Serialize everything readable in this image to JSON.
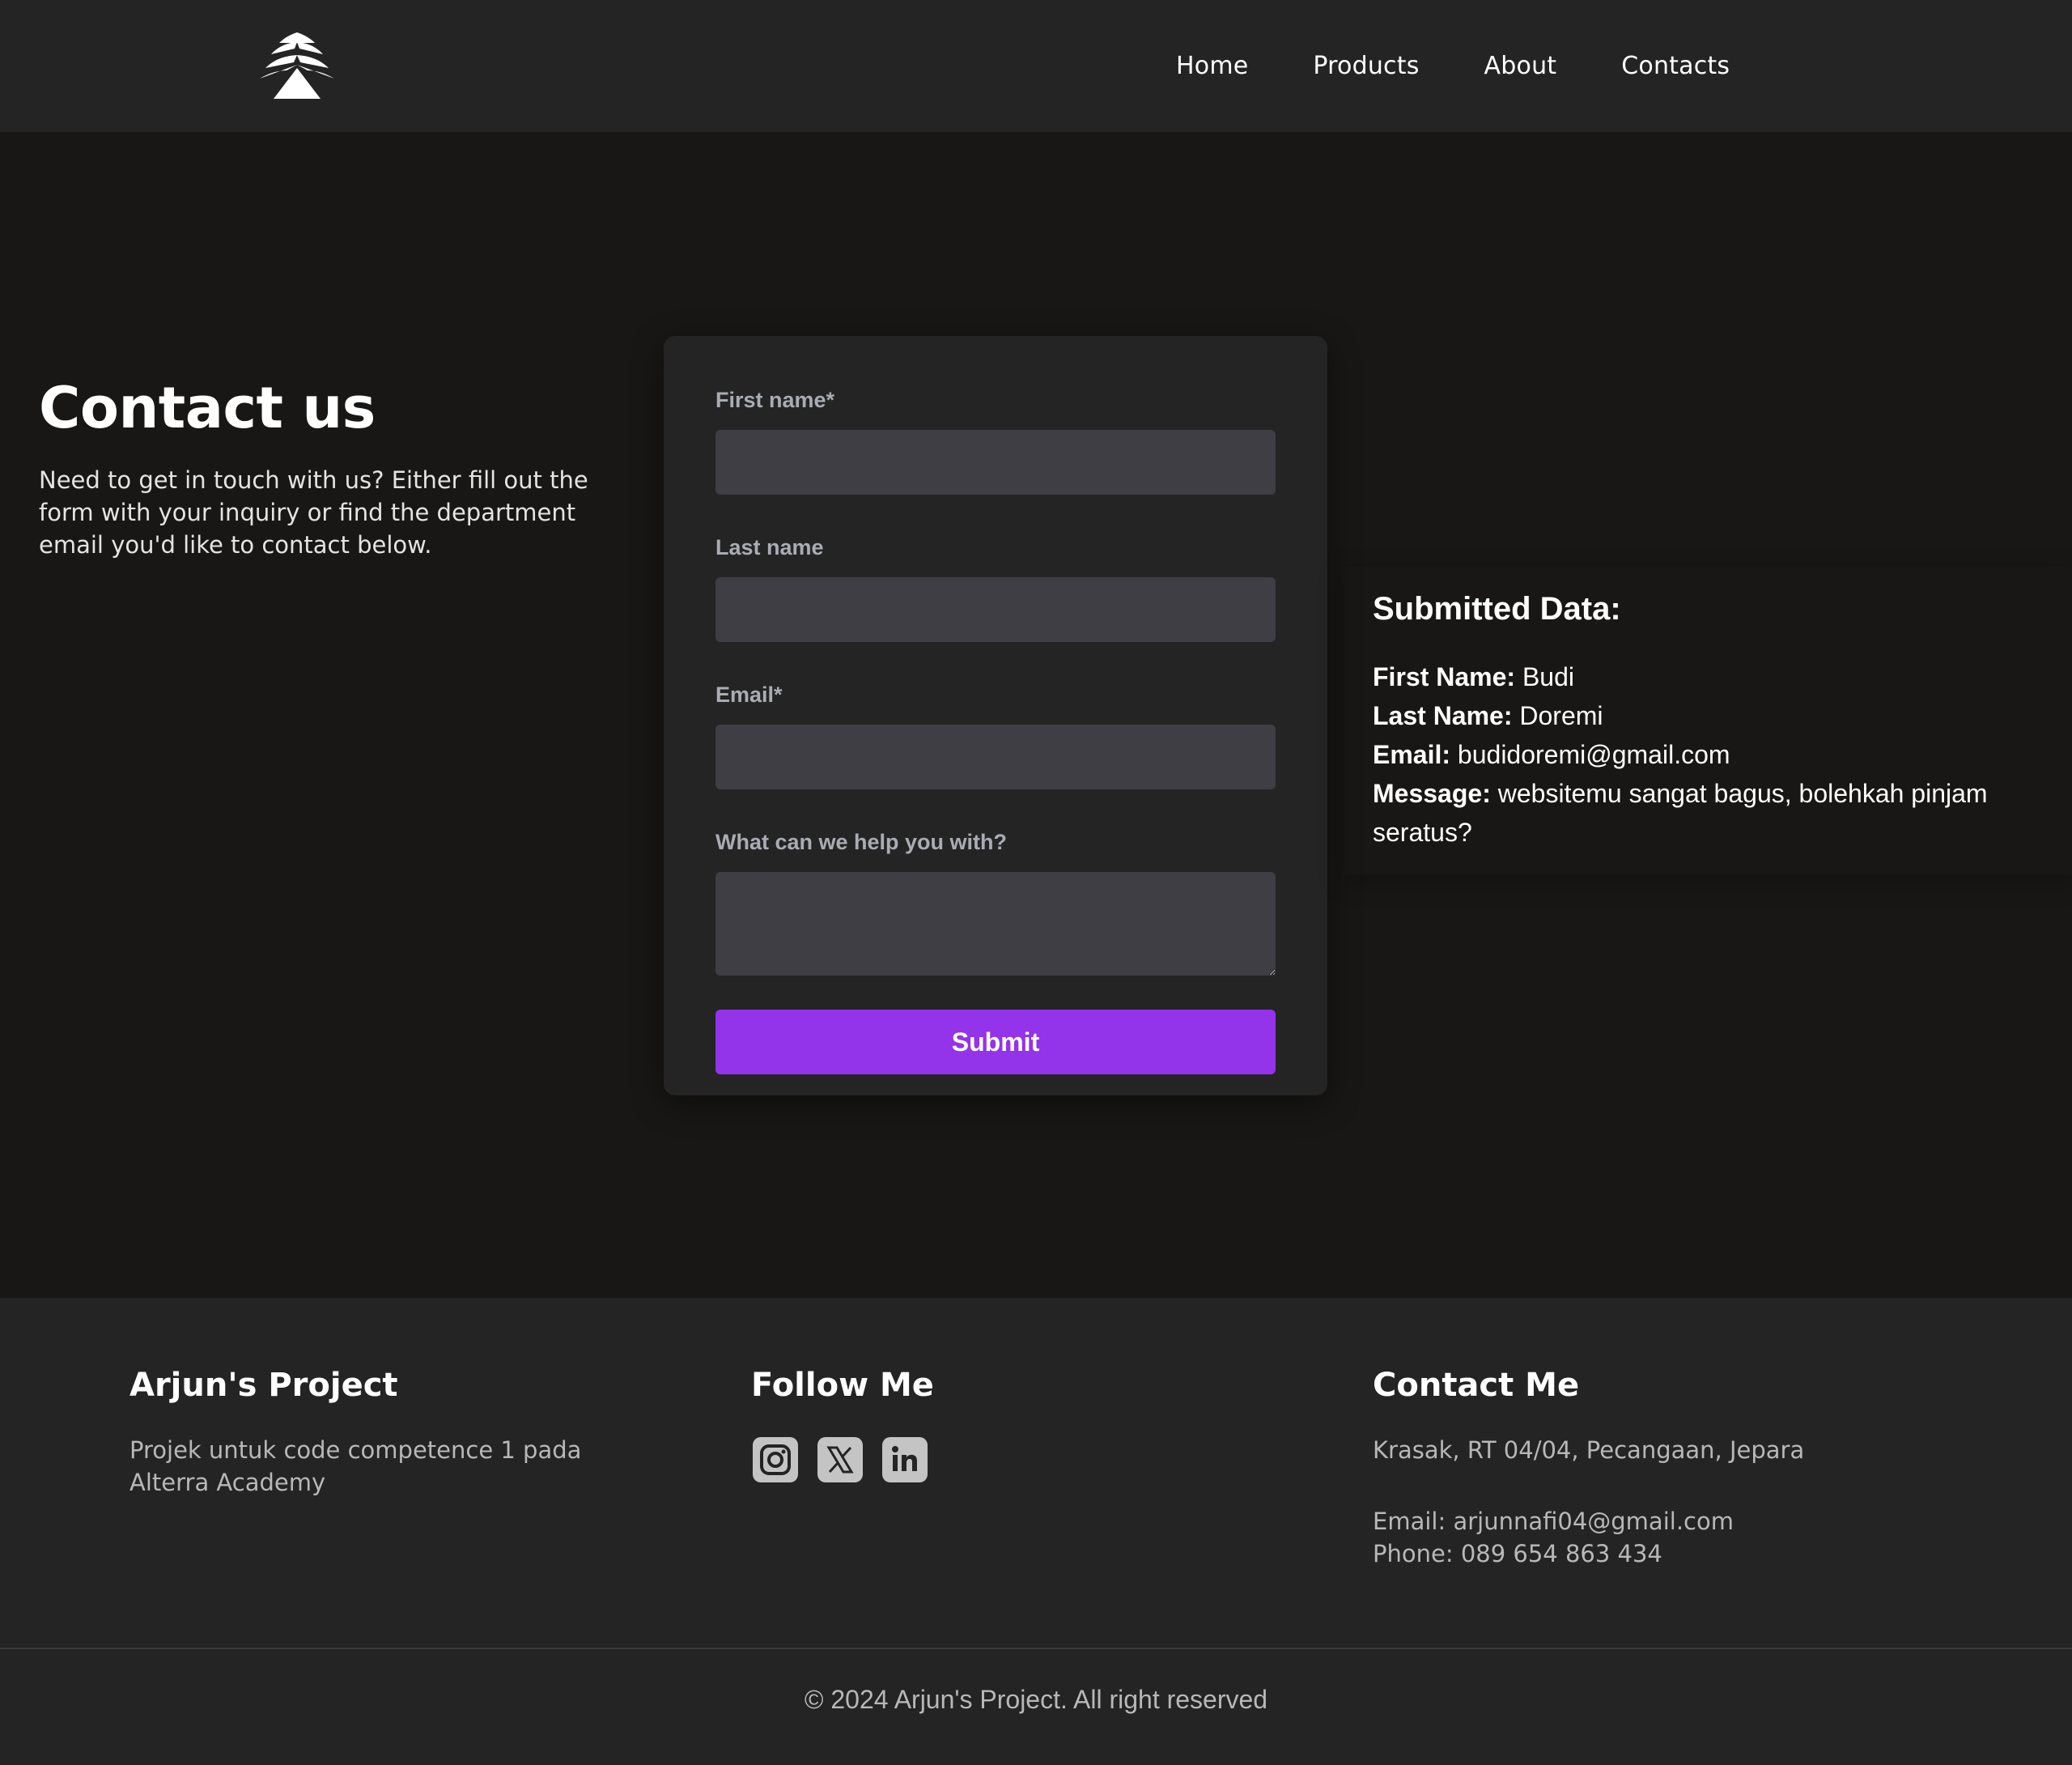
{
  "nav": {
    "logo_icon": "pine-tree-icon",
    "items": [
      {
        "label": "Home"
      },
      {
        "label": "Products"
      },
      {
        "label": "About"
      },
      {
        "label": "Contacts"
      }
    ]
  },
  "intro": {
    "title": "Contact us",
    "text": "Need to get in touch with us? Either fill out the form with your inquiry or find the department email you'd like to contact below."
  },
  "form": {
    "first_name_label": "First name*",
    "first_name_value": "",
    "last_name_label": "Last name",
    "last_name_value": "",
    "email_label": "Email*",
    "email_value": "",
    "message_label": "What can we help you with?",
    "message_value": "",
    "submit_label": "Submit"
  },
  "submitted": {
    "title": "Submitted Data:",
    "first_name_key": "First Name:",
    "first_name": "Budi",
    "last_name_key": "Last Name:",
    "last_name": "Doremi",
    "email_key": "Email:",
    "email": "budidoremi@gmail.com",
    "message_key": "Message:",
    "message": "websitemu sangat bagus, bolehkah pinjam seratus?"
  },
  "footer": {
    "brand_title": "Arjun's Project",
    "brand_text": "Projek untuk code competence 1 pada Alterra Academy",
    "follow_title": "Follow Me",
    "socials": [
      "instagram-icon",
      "x-twitter-icon",
      "linkedin-icon"
    ],
    "contact_title": "Contact Me",
    "address": "Krasak, RT 04/04, Pecangaan, Jepara",
    "email": "Email: arjunnafi04@gmail.com",
    "phone": "Phone: 089 654 863 434",
    "copyright": "© 2024 Arjun's Project. All right reserved"
  },
  "colors": {
    "page_bg": "#181716",
    "header_bg": "#242424",
    "card_bg": "#242425",
    "input_bg": "#3e3e44",
    "accent": "#9333ea"
  }
}
